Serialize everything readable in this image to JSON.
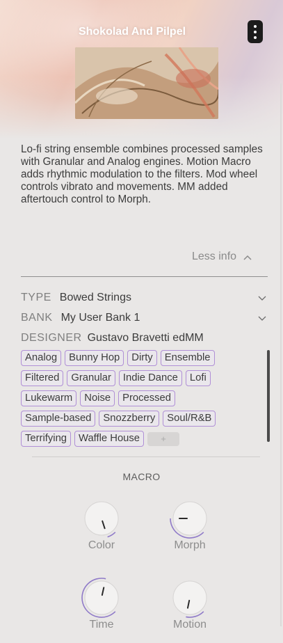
{
  "header": {
    "preset_name": "Shokolad And Pilpel",
    "menu_icon": "kebab-menu-icon",
    "artwork_icon": "preset-artwork"
  },
  "description": "Lo-fi string ensemble combines processed samples with Granular and Analog engines. Motion Macro adds rhythmic modulation to the filters. Mod wheel controls vibrato and movements. MM added aftertouch control to Morph.",
  "info_toggle": {
    "label": "Less info",
    "icon": "chevron-up-icon"
  },
  "meta": {
    "type_key": "TYPE",
    "type_value": "Bowed Strings",
    "bank_key": "BANK",
    "bank_value": "My User Bank 1",
    "designer_key": "DESIGNER",
    "designer_value": "Gustavo Bravetti edMM"
  },
  "tags": {
    "rows": [
      [
        "Analog",
        "Bunny Hop",
        "Dirty",
        "Ensemble"
      ],
      [
        "Filtered",
        "Granular",
        "Indie Dance",
        "Lofi"
      ],
      [
        "Lukewarm",
        "Noise",
        "Processed"
      ],
      [
        "Sample-based",
        "Snozzberry",
        "Soul/R&B"
      ],
      [
        "Terrifying",
        "Waffle House"
      ]
    ],
    "add_label": "+",
    "tag_border_color": "#b08fd6"
  },
  "macro": {
    "title": "MACRO",
    "accent_color": "#8f7ac8",
    "knobs": [
      {
        "label": "Color",
        "value": 0.1
      },
      {
        "label": "Morph",
        "value": 0.5
      },
      {
        "label": "Time",
        "value": 0.88
      },
      {
        "label": "Motion",
        "value": 0.21
      }
    ]
  }
}
